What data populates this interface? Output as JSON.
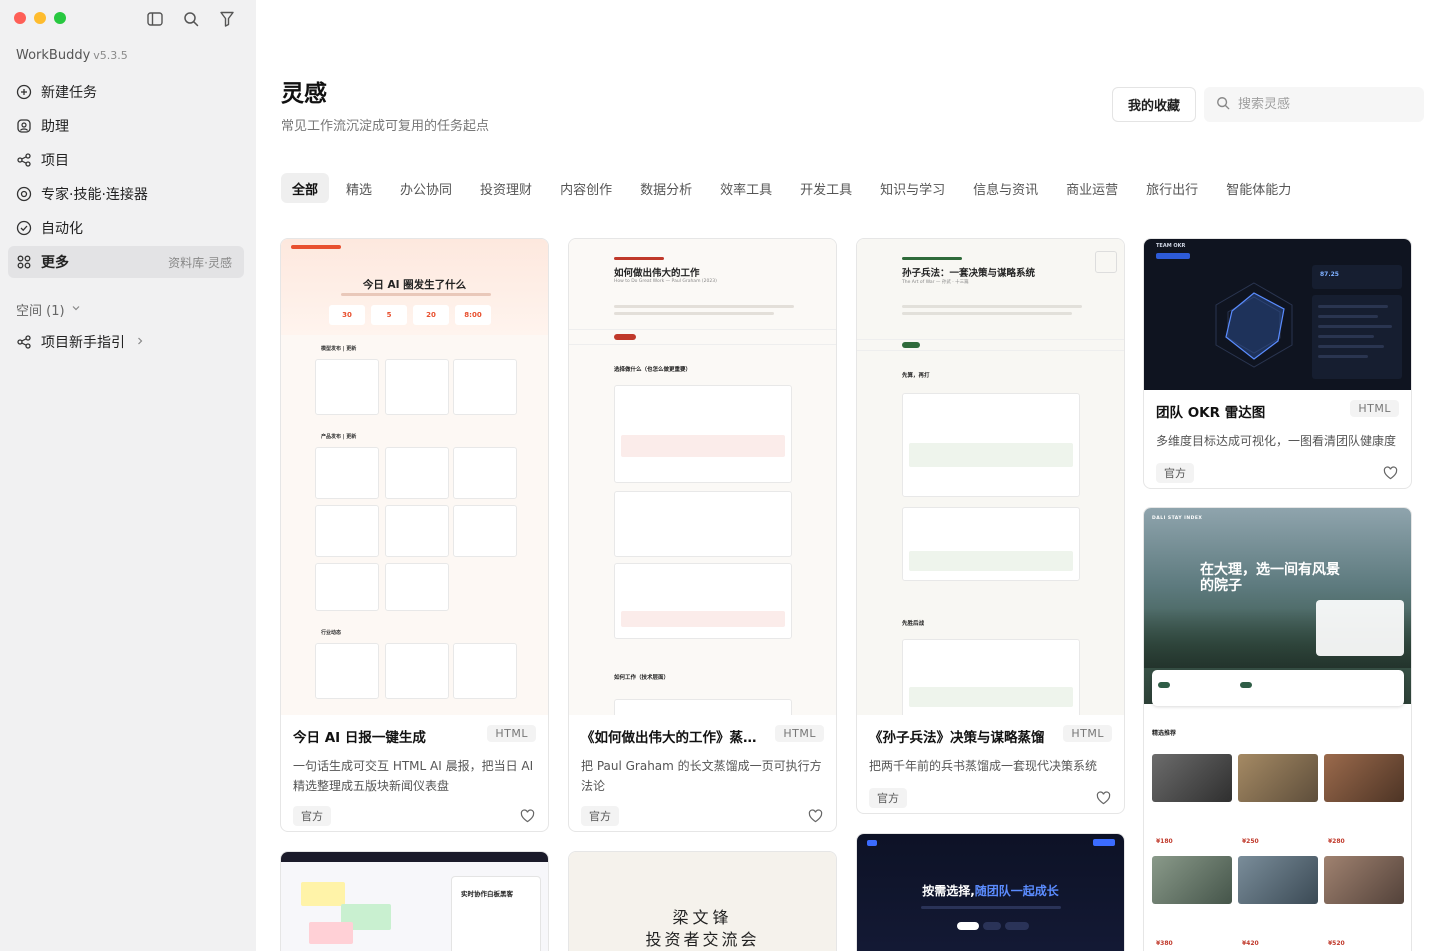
{
  "app": {
    "name": "WorkBuddy",
    "version": "v5.3.5"
  },
  "sidebar": {
    "items": [
      {
        "label": "新建任务",
        "icon": "plus-circle-icon"
      },
      {
        "label": "助理",
        "icon": "assistant-icon"
      },
      {
        "label": "项目",
        "icon": "project-icon"
      },
      {
        "label": "专家·技能·连接器",
        "icon": "expert-icon"
      },
      {
        "label": "自动化",
        "icon": "automation-icon"
      },
      {
        "label": "更多",
        "icon": "more-icon",
        "right": "资料库·灵感"
      }
    ],
    "space_label": "空间 (1)",
    "guide_label": "项目新手指引"
  },
  "header": {
    "title": "灵感",
    "subtitle": "常见工作流沉淀成可复用的任务起点",
    "fav_label": "我的收藏",
    "search_placeholder": "搜索灵感"
  },
  "tabs": [
    "全部",
    "精选",
    "办公协同",
    "投资理财",
    "内容创作",
    "数据分析",
    "效率工具",
    "开发工具",
    "知识与学习",
    "信息与资讯",
    "商业运营",
    "旅行出行",
    "智能体能力"
  ],
  "cards": [
    {
      "title": "今日 AI 日报一键生成",
      "badge": "HTML",
      "desc": "一句话生成可交互 HTML AI 晨报，把当日 AI 精选整理成五版块新闻仪表盘",
      "tag": "官方"
    },
    {
      "title": "《如何做出伟大的工作》蒸馏…",
      "badge": "HTML",
      "desc": "把 Paul Graham 的长文蒸馏成一页可执行方法论",
      "tag": "官方"
    },
    {
      "title": "《孙子兵法》决策与谋略蒸馏",
      "badge": "HTML",
      "desc": "把两千年前的兵书蒸馏成一套现代决策系统",
      "tag": "官方"
    },
    {
      "title": "团队 OKR 雷达图",
      "badge": "HTML",
      "desc": "多维度目标达成可视化，一图看清团队健康度",
      "tag": "官方"
    }
  ],
  "thumbs": {
    "ai_daily": {
      "heading": "今日 AI 圈发生了什么",
      "stats": [
        "30",
        "5",
        "20",
        "8:00"
      ],
      "sec1": "模型发布 | 更新",
      "sec2": "产品发布 | 更新",
      "sec3": "行业动态"
    },
    "great_work": {
      "heading": "如何做出伟大的工作",
      "sub": "How to Do Great Work — Paul Graham (2023)",
      "s1": "选择做什么（也怎么做更重要）",
      "s2": "如何工作（技术层面）"
    },
    "sunzi": {
      "heading": "孙子兵法：一套决策与谋略系统",
      "sub": "The Art of War — 孙武 · 十三篇",
      "s1": "先算，再打",
      "s2": "先胜后战"
    },
    "okr": {
      "label": "TEAM OKR",
      "score": "87.25"
    },
    "dali": {
      "label": "DALI STAY INDEX",
      "heading": "在大理，选一间有风景的院子",
      "section": "精选推荐",
      "prices": [
        "¥180",
        "¥250",
        "¥280",
        "¥380",
        "¥420",
        "¥520"
      ]
    },
    "collab": {
      "heading": "实时协作白板黑客"
    },
    "investor": {
      "line1": "梁文锋",
      "line2": "投资者交流会"
    },
    "growth": {
      "heading_a": "按需选择,",
      "heading_b": "随团队一起成长"
    }
  },
  "colors": {
    "accent": "#e8502f",
    "sidebar_bg": "#f1f1f2",
    "active_bg": "#e3e3e5"
  }
}
